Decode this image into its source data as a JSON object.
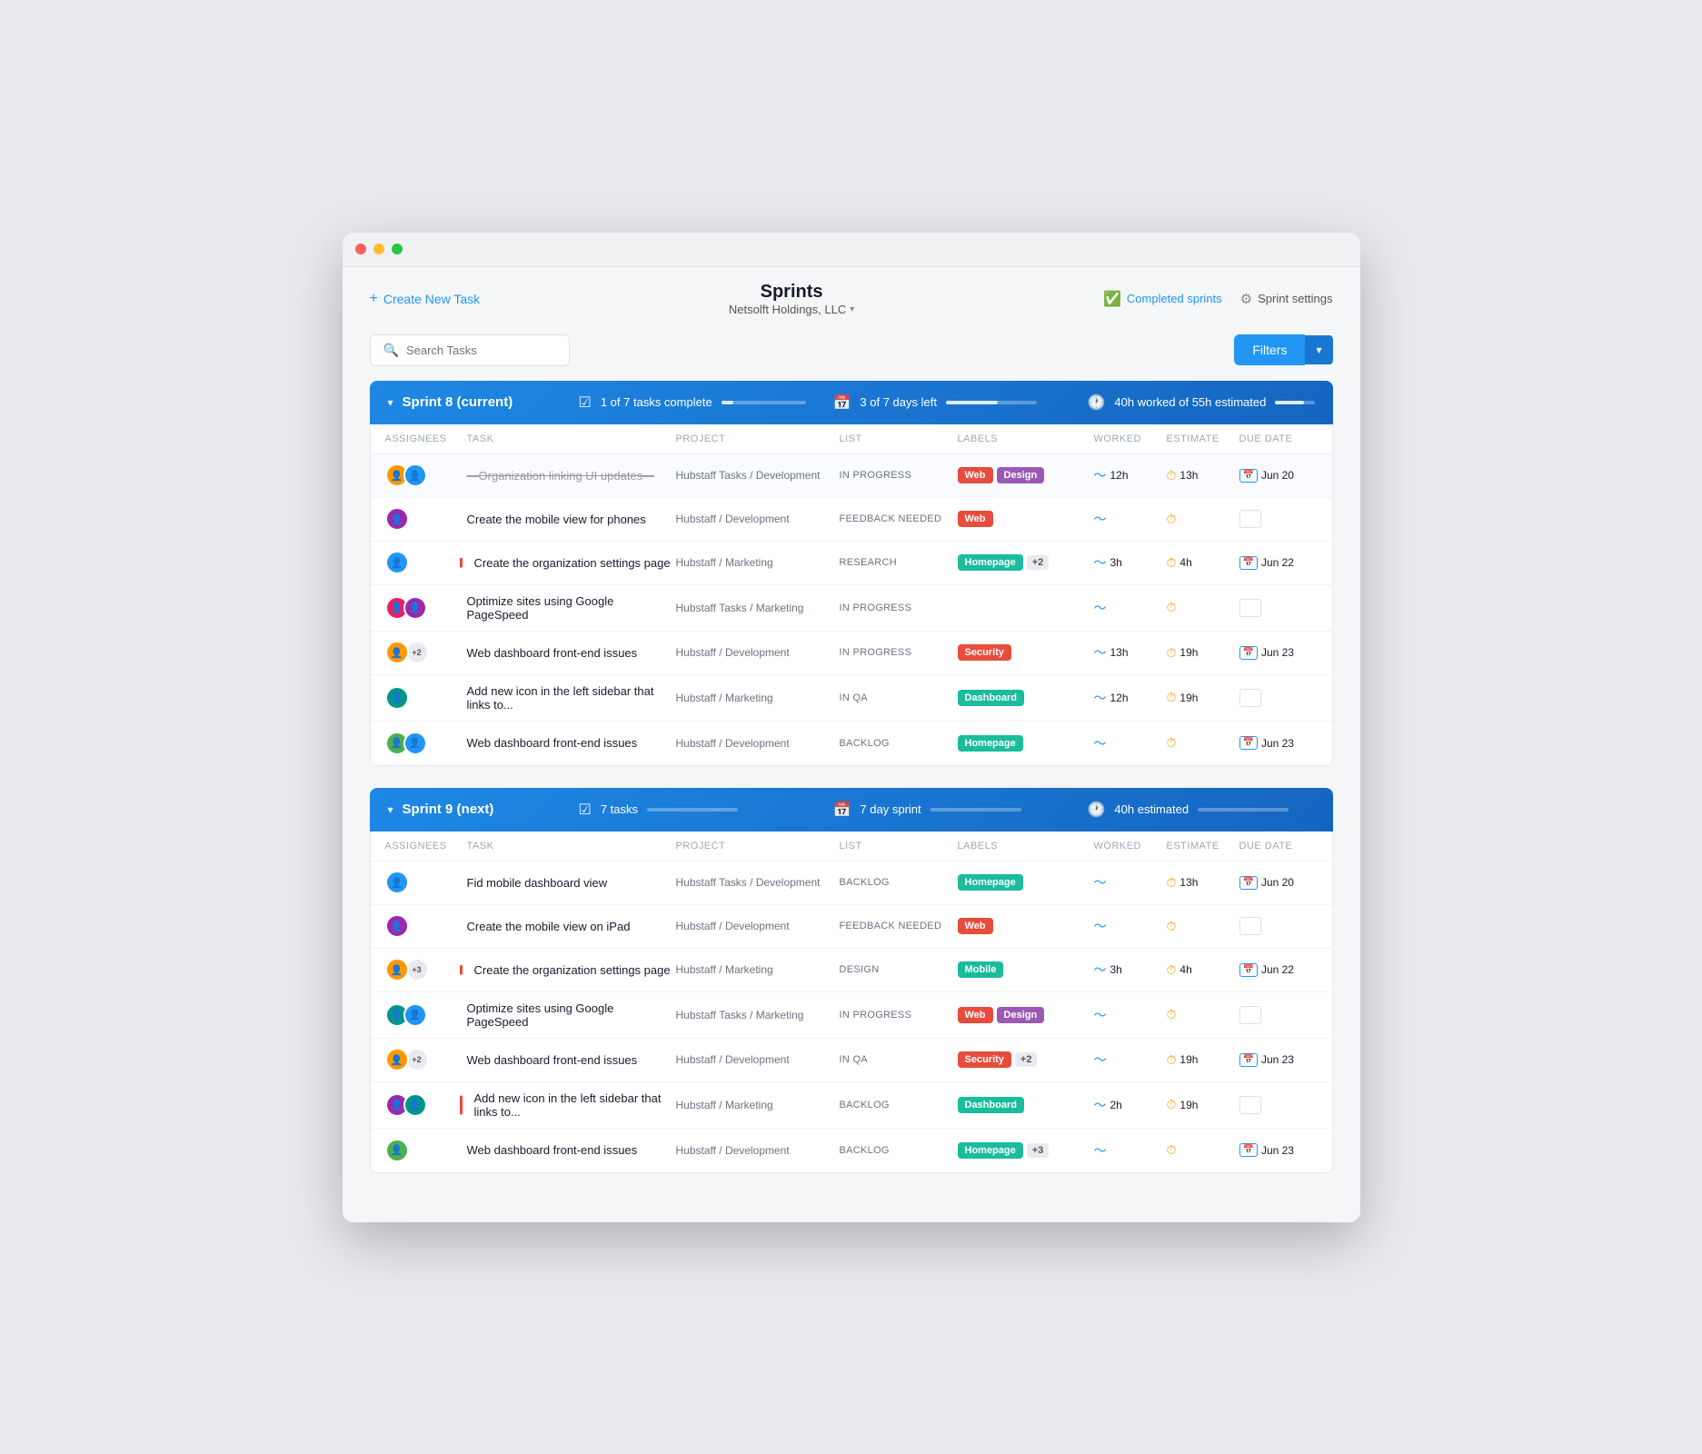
{
  "window": {
    "title": "Sprints"
  },
  "header": {
    "create_task_label": "Create New Task",
    "page_title": "Sprints",
    "org_name": "Netsolft Holdings, LLC",
    "completed_sprints_label": "Completed sprints",
    "sprint_settings_label": "Sprint settings"
  },
  "toolbar": {
    "search_placeholder": "Search Tasks",
    "filters_label": "Filters"
  },
  "sprint8": {
    "name": "Sprint 8 (current)",
    "stat1_text": "1 of 7 tasks complete",
    "stat1_bar": 14,
    "stat2_text": "3 of 7 days left",
    "stat2_bar": 57,
    "stat3_text": "40h worked of 55h estimated",
    "stat3_bar": 73,
    "columns": [
      "Assignees",
      "Task",
      "Project",
      "List",
      "Labels",
      "Worked",
      "Estimate",
      "Due Date"
    ],
    "rows": [
      {
        "avatars": [
          "orange",
          "blue"
        ],
        "task": "—Organization linking UI updates—",
        "strikethrough": true,
        "red_bar": false,
        "project": "Hubstaff Tasks / Development",
        "list": "IN PROGRESS",
        "labels": [
          {
            "text": "Web",
            "class": "label-web"
          },
          {
            "text": "Design",
            "class": "label-design"
          }
        ],
        "worked": "12h",
        "estimate": "13h",
        "due": "Jun 20",
        "completed": true
      },
      {
        "avatars": [
          "purple"
        ],
        "task": "Create the mobile view for phones",
        "strikethrough": false,
        "red_bar": false,
        "project": "Hubstaff / Development",
        "list": "FEEDBACK NEEDED",
        "labels": [
          {
            "text": "Web",
            "class": "label-web"
          }
        ],
        "worked": "",
        "estimate": "",
        "due": "",
        "completed": false
      },
      {
        "avatars": [
          "blue"
        ],
        "task": "Create the organization settings page",
        "strikethrough": false,
        "red_bar": true,
        "project": "Hubstaff / Marketing",
        "list": "RESEARCH",
        "labels": [
          {
            "text": "Homepage",
            "class": "label-homepage"
          },
          {
            "text": "+2",
            "class": "label-count",
            "count": true
          }
        ],
        "worked": "3h",
        "estimate": "4h",
        "due": "Jun 22",
        "completed": false
      },
      {
        "avatars": [
          "pink",
          "purple"
        ],
        "task": "Optimize sites using Google PageSpeed",
        "strikethrough": false,
        "red_bar": false,
        "project": "Hubstaff Tasks / Marketing",
        "list": "IN PROGRESS",
        "labels": [],
        "worked": "",
        "estimate": "",
        "due": "",
        "completed": false
      },
      {
        "avatars": [
          "orange",
          "extra2"
        ],
        "task": "Web dashboard front-end issues",
        "strikethrough": false,
        "red_bar": false,
        "project": "Hubstaff / Development",
        "list": "IN PROGRESS",
        "labels": [
          {
            "text": "Security",
            "class": "label-security"
          }
        ],
        "worked": "13h",
        "estimate": "19h",
        "due": "Jun 23",
        "completed": false
      },
      {
        "avatars": [
          "teal"
        ],
        "task": "Add new icon in the left sidebar that links to...",
        "strikethrough": false,
        "red_bar": false,
        "project": "Hubstaff / Marketing",
        "list": "IN QA",
        "labels": [
          {
            "text": "Dashboard",
            "class": "label-dashboard"
          }
        ],
        "worked": "12h",
        "estimate": "19h",
        "due": "",
        "completed": false
      },
      {
        "avatars": [
          "green",
          "blue"
        ],
        "task": "Web dashboard front-end issues",
        "strikethrough": false,
        "red_bar": false,
        "project": "Hubstaff / Development",
        "list": "BACKLOG",
        "labels": [
          {
            "text": "Homepage",
            "class": "label-homepage"
          }
        ],
        "worked": "",
        "estimate": "",
        "due": "Jun 23",
        "completed": false
      }
    ]
  },
  "sprint9": {
    "name": "Sprint 9 (next)",
    "stat1_text": "7 tasks",
    "stat1_bar": 0,
    "stat2_text": "7 day sprint",
    "stat2_bar": 0,
    "stat3_text": "40h estimated",
    "stat3_bar": 0,
    "columns": [
      "Assignees",
      "Task",
      "Project",
      "List",
      "Labels",
      "Worked",
      "Estimate",
      "Due Date"
    ],
    "rows": [
      {
        "avatars": [
          "blue"
        ],
        "task": "Fid mobile dashboard view",
        "strikethrough": false,
        "red_bar": false,
        "project": "Hubstaff Tasks / Development",
        "list": "BACKLOG",
        "labels": [
          {
            "text": "Homepage",
            "class": "label-homepage"
          }
        ],
        "worked": "",
        "estimate": "13h",
        "due": "Jun 20",
        "completed": false
      },
      {
        "avatars": [
          "purple"
        ],
        "task": "Create the mobile view on iPad",
        "strikethrough": false,
        "red_bar": false,
        "project": "Hubstaff / Development",
        "list": "FEEDBACK NEEDED",
        "labels": [
          {
            "text": "Web",
            "class": "label-web"
          }
        ],
        "worked": "",
        "estimate": "",
        "due": "",
        "completed": false
      },
      {
        "avatars": [
          "orange",
          "extra3"
        ],
        "task": "Create the organization settings page",
        "strikethrough": false,
        "red_bar": true,
        "project": "Hubstaff / Marketing",
        "list": "DESIGN",
        "labels": [
          {
            "text": "Mobile",
            "class": "label-mobile"
          }
        ],
        "worked": "3h",
        "estimate": "4h",
        "due": "Jun 22",
        "completed": false
      },
      {
        "avatars": [
          "teal",
          "blue"
        ],
        "task": "Optimize sites using Google PageSpeed",
        "strikethrough": false,
        "red_bar": false,
        "project": "Hubstaff Tasks / Marketing",
        "list": "IN PROGRESS",
        "labels": [
          {
            "text": "Web",
            "class": "label-web"
          },
          {
            "text": "Design",
            "class": "label-design"
          }
        ],
        "worked": "",
        "estimate": "",
        "due": "",
        "completed": false
      },
      {
        "avatars": [
          "orange",
          "extra2"
        ],
        "task": "Web dashboard front-end issues",
        "strikethrough": false,
        "red_bar": false,
        "project": "Hubstaff / Development",
        "list": "IN QA",
        "labels": [
          {
            "text": "Security",
            "class": "label-security"
          },
          {
            "text": "+2",
            "class": "label-count",
            "count": true
          }
        ],
        "worked": "",
        "estimate": "19h",
        "due": "Jun 23",
        "completed": false
      },
      {
        "avatars": [
          "purple",
          "teal"
        ],
        "task": "Add new icon in the left sidebar that links to...",
        "strikethrough": false,
        "red_bar": true,
        "project": "Hubstaff / Marketing",
        "list": "BACKLOG",
        "labels": [
          {
            "text": "Dashboard",
            "class": "label-dashboard"
          }
        ],
        "worked": "2h",
        "estimate": "19h",
        "due": "",
        "completed": false
      },
      {
        "avatars": [
          "green"
        ],
        "task": "Web dashboard front-end issues",
        "strikethrough": false,
        "red_bar": false,
        "project": "Hubstaff / Development",
        "list": "BACKLOG",
        "labels": [
          {
            "text": "Homepage",
            "class": "label-homepage"
          },
          {
            "text": "+3",
            "class": "label-count",
            "count": true
          }
        ],
        "worked": "",
        "estimate": "",
        "due": "Jun 23",
        "completed": false
      }
    ]
  }
}
